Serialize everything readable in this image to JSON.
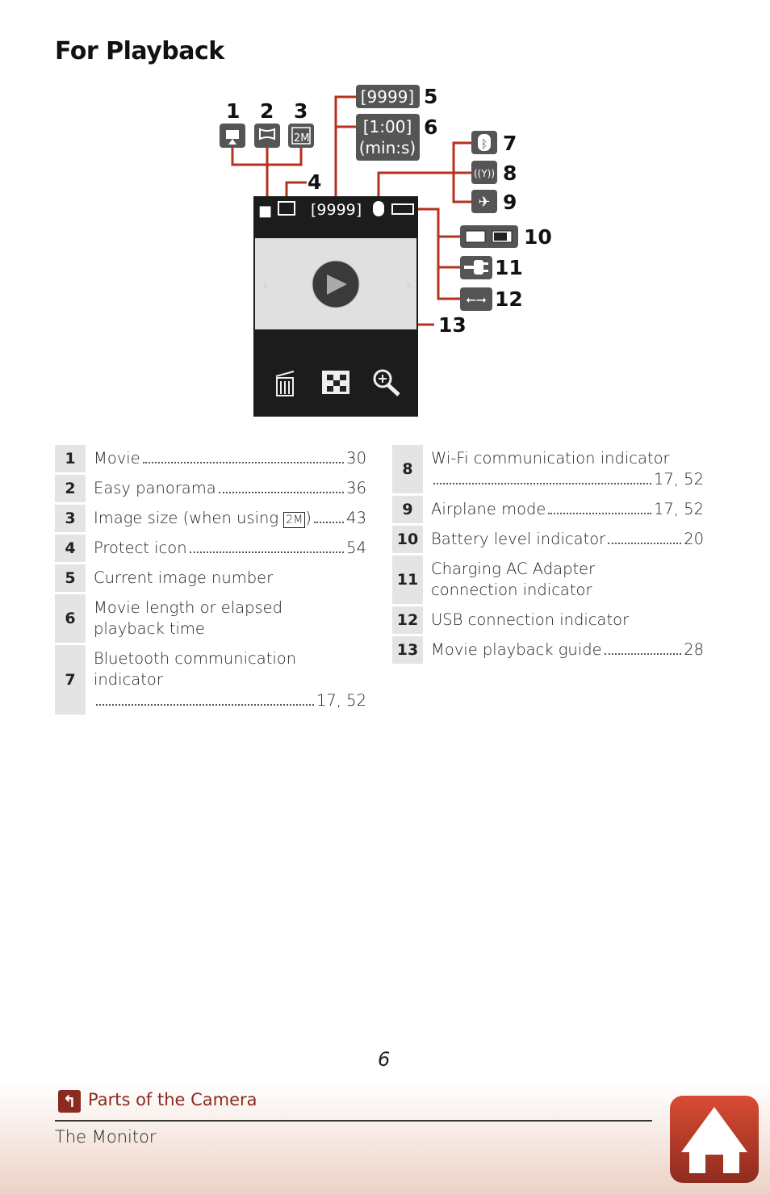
{
  "title": "For Playback",
  "diagram": {
    "callouts": [
      "1",
      "2",
      "3",
      "4",
      "5",
      "6",
      "7",
      "8",
      "9",
      "10",
      "11",
      "12",
      "13"
    ],
    "box5": "[9999]",
    "box6_line1": "[1:00]",
    "box6_line2": "(min:s)",
    "status_number": "[9999]",
    "icon3_text": "2M",
    "line_color": "#b5321f"
  },
  "left_items": [
    {
      "num": "1",
      "label": "Movie",
      "page": "30"
    },
    {
      "num": "2",
      "label": "Easy panorama",
      "page": "36"
    },
    {
      "num": "3",
      "label": "Image size (when using ",
      "icon": "2M",
      "label2": ")",
      "page": "43"
    },
    {
      "num": "4",
      "label": "Protect icon",
      "page": "54"
    },
    {
      "num": "5",
      "label": "Current image number"
    },
    {
      "num": "6",
      "label": "Movie length or elapsed playback time"
    },
    {
      "num": "7",
      "label": "Bluetooth communication indicator",
      "page": "17, 52"
    }
  ],
  "right_items": [
    {
      "num": "8",
      "label": "Wi-Fi communication indicator",
      "page": "17, 52"
    },
    {
      "num": "9",
      "label": "Airplane mode",
      "page": "17, 52"
    },
    {
      "num": "10",
      "label": "Battery level indicator",
      "page": "20"
    },
    {
      "num": "11",
      "label": "Charging AC Adapter connection indicator"
    },
    {
      "num": "12",
      "label": "USB connection indicator"
    },
    {
      "num": "13",
      "label": "Movie playback guide",
      "page": "28"
    }
  ],
  "footer": {
    "page_number": "6",
    "section": "Parts of the Camera",
    "subsection": "The Monitor",
    "back_icon": "arrow-back-icon",
    "home_icon": "home-icon"
  }
}
